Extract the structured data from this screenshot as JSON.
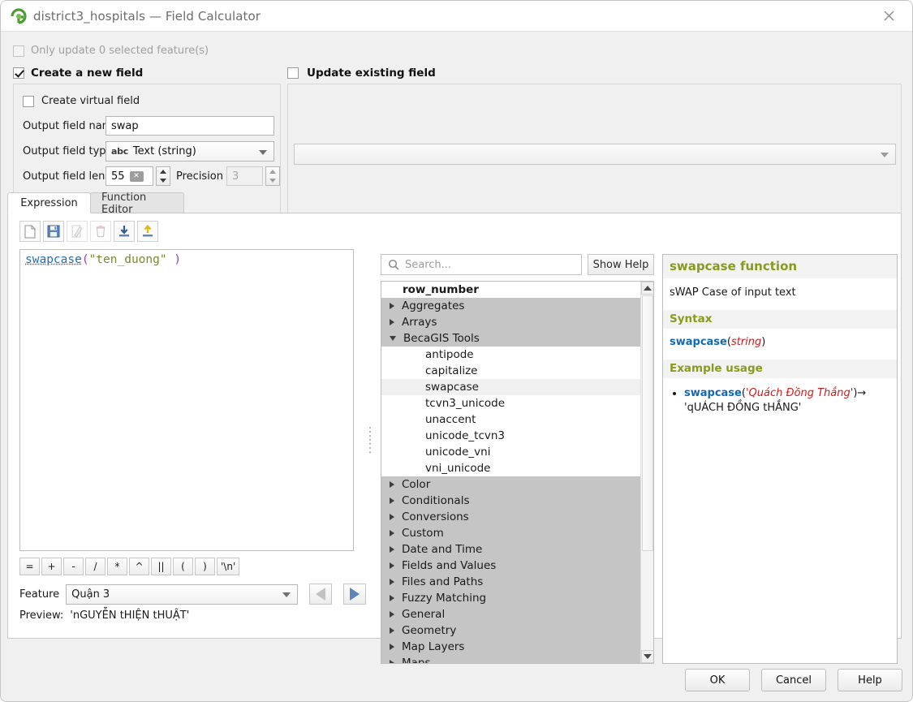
{
  "window": {
    "title": "district3_hospitals — Field Calculator",
    "logo_icon": "qgis-logo-icon",
    "close_icon": "close-icon"
  },
  "options": {
    "only_update_selected": "Only update 0 selected feature(s)",
    "create_new_field": "Create a new field",
    "update_existing_field": "Update existing field",
    "create_virtual_field": "Create virtual field"
  },
  "new_field": {
    "name_label": "Output field name",
    "name_value": "swap",
    "type_label": "Output field type",
    "type_value": "Text (string)",
    "type_badge": "abc",
    "length_label": "Output field length",
    "length_value": "55",
    "precision_label": "Precision",
    "precision_value": "3"
  },
  "update_field": {
    "selected_value": ""
  },
  "tabs": [
    {
      "label": "Expression",
      "active": true
    },
    {
      "label": "Function Editor",
      "active": false
    }
  ],
  "expression_toolbar": [
    {
      "icon": "new-file-icon",
      "enabled": true
    },
    {
      "icon": "save-icon",
      "enabled": true
    },
    {
      "icon": "edit-pencil-icon",
      "enabled": false
    },
    {
      "icon": "trash-icon",
      "enabled": false
    },
    {
      "icon": "import-download-icon",
      "enabled": true
    },
    {
      "icon": "export-upload-icon",
      "enabled": true
    }
  ],
  "expression": {
    "function": "swapcase",
    "open_paren": "(",
    "string_arg": "\"ten_duong\"",
    "close_paren": ")"
  },
  "operators": [
    "=",
    "+",
    "-",
    "/",
    "*",
    "^",
    "||",
    "(",
    ")",
    "'\\n'"
  ],
  "feature": {
    "label": "Feature",
    "value": "Quận 3",
    "prev_icon": "previous-feature-icon",
    "next_icon": "next-feature-icon"
  },
  "preview": {
    "label": "Preview:",
    "value": "'nGUYỄN tHIỆN tHUẬT'"
  },
  "search": {
    "placeholder": "Search...",
    "icon": "search-icon"
  },
  "show_help_button": "Show Help",
  "function_tree": [
    {
      "label": "row_number",
      "kind": "root",
      "expander": "none"
    },
    {
      "label": "Aggregates",
      "kind": "group",
      "expander": "collapsed"
    },
    {
      "label": "Arrays",
      "kind": "group",
      "expander": "collapsed"
    },
    {
      "label": "BecaGIS Tools",
      "kind": "group",
      "expander": "expanded"
    },
    {
      "label": "antipode",
      "kind": "leaf",
      "expander": "none",
      "selected": false
    },
    {
      "label": "capitalize",
      "kind": "leaf",
      "expander": "none",
      "selected": false
    },
    {
      "label": "swapcase",
      "kind": "leaf",
      "expander": "none",
      "selected": true
    },
    {
      "label": "tcvn3_unicode",
      "kind": "leaf",
      "expander": "none",
      "selected": false
    },
    {
      "label": "unaccent",
      "kind": "leaf",
      "expander": "none",
      "selected": false
    },
    {
      "label": "unicode_tcvn3",
      "kind": "leaf",
      "expander": "none",
      "selected": false
    },
    {
      "label": "unicode_vni",
      "kind": "leaf",
      "expander": "none",
      "selected": false
    },
    {
      "label": "vni_unicode",
      "kind": "leaf",
      "expander": "none",
      "selected": false
    },
    {
      "label": "Color",
      "kind": "group",
      "expander": "collapsed"
    },
    {
      "label": "Conditionals",
      "kind": "group",
      "expander": "collapsed"
    },
    {
      "label": "Conversions",
      "kind": "group",
      "expander": "collapsed"
    },
    {
      "label": "Custom",
      "kind": "group",
      "expander": "collapsed"
    },
    {
      "label": "Date and Time",
      "kind": "group",
      "expander": "collapsed"
    },
    {
      "label": "Fields and Values",
      "kind": "group",
      "expander": "collapsed"
    },
    {
      "label": "Files and Paths",
      "kind": "group",
      "expander": "collapsed"
    },
    {
      "label": "Fuzzy Matching",
      "kind": "group",
      "expander": "collapsed"
    },
    {
      "label": "General",
      "kind": "group",
      "expander": "collapsed"
    },
    {
      "label": "Geometry",
      "kind": "group",
      "expander": "collapsed"
    },
    {
      "label": "Map Layers",
      "kind": "group",
      "expander": "collapsed"
    },
    {
      "label": "Maps",
      "kind": "group",
      "expander": "collapsed"
    }
  ],
  "help": {
    "title": "swapcase function",
    "description": "sWAP Case of input text",
    "syntax_heading": "Syntax",
    "syntax_fn": "swapcase",
    "syntax_open": "(",
    "syntax_arg": "string",
    "syntax_close": ")",
    "example_heading": "Example usage",
    "example_fn": "swapcase",
    "example_open": "(",
    "example_arg": "'Quách Đồng Thắng'",
    "example_close": ")",
    "example_arrow": "→",
    "example_result": "'qUÁCH ĐỒNG tHẮNG'"
  },
  "dialog_buttons": [
    {
      "label": "OK"
    },
    {
      "label": "Cancel"
    },
    {
      "label": "Help"
    }
  ],
  "colors": {
    "accent_blue": "#1268b3",
    "help_heading": "#8a9a1c",
    "arg_red": "#d11a1a",
    "string_olive": "#7a8a2e",
    "paren_purple": "#9a3fbf",
    "group_row": "#c5c5c5"
  }
}
